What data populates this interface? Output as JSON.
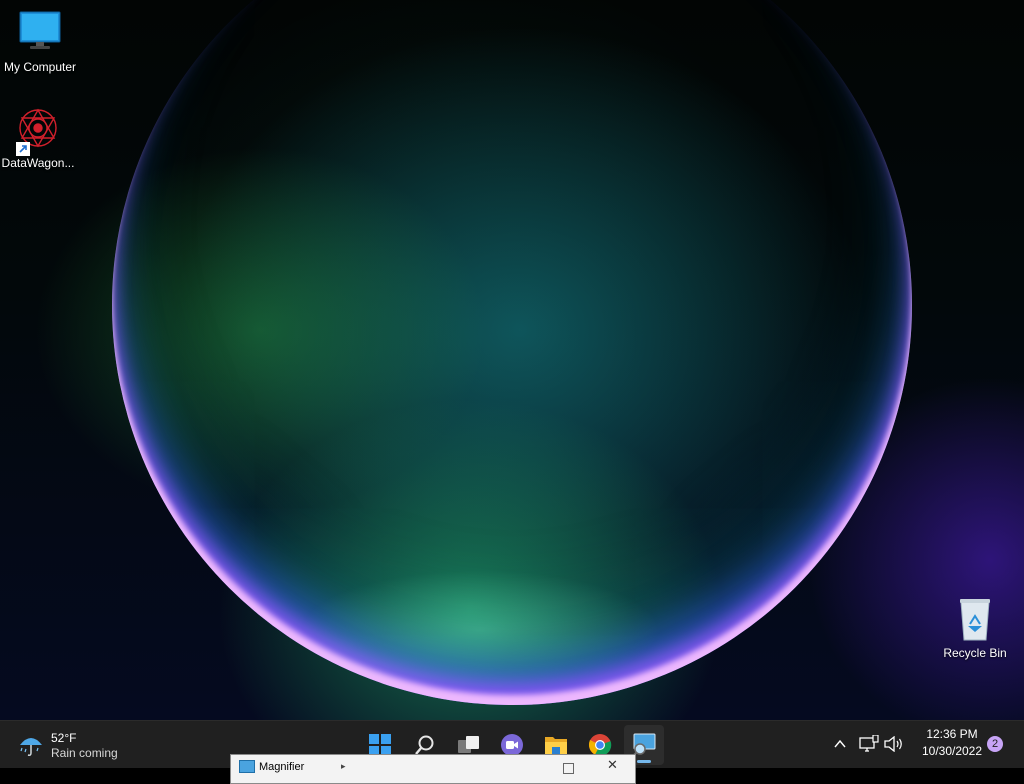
{
  "desktop": {
    "icons": [
      {
        "label": "My Computer",
        "icon": "monitor-icon"
      },
      {
        "label": "DataWagon...",
        "icon": "datawagon-shortcut-icon"
      },
      {
        "label": "Recycle Bin",
        "icon": "recycle-bin-icon"
      }
    ]
  },
  "taskbar": {
    "weather": {
      "temp": "52°F",
      "desc": "Rain coming",
      "icon": "umbrella-rain-icon"
    },
    "apps": [
      {
        "name": "Start",
        "icon": "windows-start-icon"
      },
      {
        "name": "Search",
        "icon": "search-icon"
      },
      {
        "name": "Task View",
        "icon": "task-view-icon"
      },
      {
        "name": "Chat",
        "icon": "teams-chat-icon"
      },
      {
        "name": "File Explorer",
        "icon": "folder-icon"
      },
      {
        "name": "Google Chrome",
        "icon": "chrome-icon"
      },
      {
        "name": "Magnifier",
        "icon": "magnifier-app-icon"
      }
    ],
    "tray": {
      "overflow_icon": "chevron-up-icon",
      "network_icon": "network-icon",
      "volume_icon": "volume-icon"
    },
    "clock": {
      "time": "12:36 PM",
      "date": "10/30/2022"
    },
    "notifications": "2"
  },
  "magnifier_window": {
    "title": "Magnifier"
  },
  "colors": {
    "taskbar_bg": "#202020",
    "accent": "#76b9ed"
  }
}
